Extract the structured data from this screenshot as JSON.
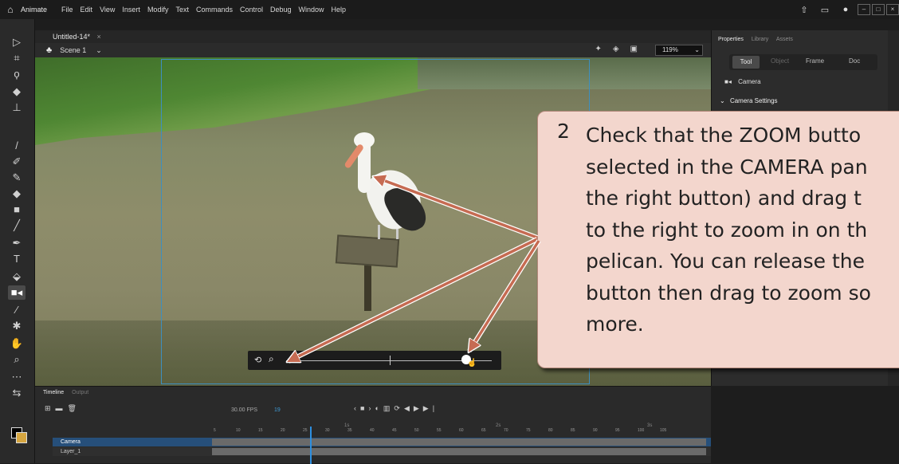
{
  "menubar": {
    "app_name": "Animate",
    "items": [
      "File",
      "Edit",
      "View",
      "Insert",
      "Modify",
      "Text",
      "Commands",
      "Control",
      "Debug",
      "Window",
      "Help"
    ],
    "home_icon": "home-icon",
    "right_icons": [
      "share-icon",
      "layout-icon",
      "record-icon"
    ]
  },
  "document": {
    "tab_title": "Untitled-14*",
    "tab_close": "×",
    "scene_name": "Scene 1",
    "zoom": "119%"
  },
  "properties": {
    "tabs": [
      "Properties",
      "Library",
      "Assets"
    ],
    "active_tab": "Properties",
    "segments": [
      "Tool",
      "Object",
      "Frame",
      "Doc"
    ],
    "active_segment": "Tool",
    "camera_label": "Camera",
    "camera_settings_label": "Camera Settings"
  },
  "timeline": {
    "tabs": [
      "Timeline",
      "Output"
    ],
    "fps": "30.00",
    "fps_unit": "FPS",
    "current_frame": "19",
    "ruler": [
      "5",
      "10",
      "15",
      "20",
      "25",
      "30",
      "35",
      "40",
      "45",
      "50",
      "55",
      "60",
      "65",
      "70",
      "75",
      "80",
      "85",
      "90",
      "95",
      "100",
      "105"
    ],
    "seconds": [
      "1s",
      "2s",
      "3s"
    ],
    "layers": [
      {
        "name": "Camera",
        "selected": true
      },
      {
        "name": "Layer_1",
        "selected": false
      }
    ]
  },
  "callout": {
    "step": "2",
    "lines": [
      "Check that the ZOOM butto",
      "selected in the CAMERA pan",
      "the right button) and drag t",
      "to the right to zoom in on th",
      "pelican.  You can release the",
      "button then drag to zoom so",
      "more."
    ]
  },
  "colors": {
    "callout_bg": "#f3d6cd",
    "arrow": "#c66b52",
    "selection": "#2d8fe0",
    "camera_frame": "#3d8fbf"
  }
}
